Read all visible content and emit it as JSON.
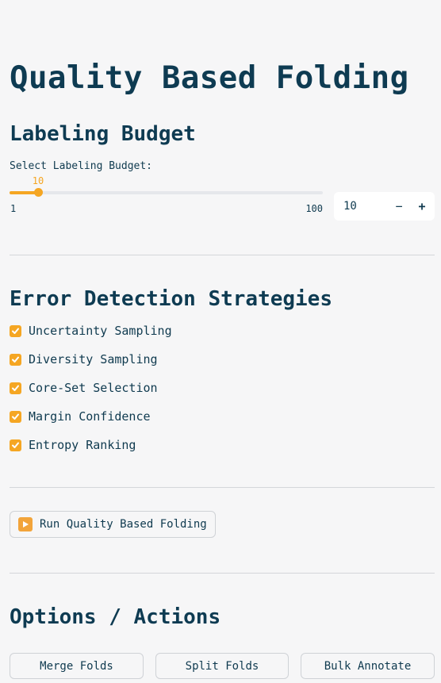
{
  "title": "Quality Based Folding",
  "budget": {
    "heading": "Labeling Budget",
    "label": "Select Labeling Budget:",
    "value": 10,
    "value_text": "10",
    "min": 1,
    "min_text": "1",
    "max": 100,
    "max_text": "100",
    "input_value": "10",
    "decrement_glyph": "−",
    "increment_glyph": "+"
  },
  "strategies": {
    "heading": "Error Detection Strategies",
    "items": [
      {
        "label": "Uncertainty Sampling",
        "checked": true
      },
      {
        "label": "Diversity Sampling",
        "checked": true
      },
      {
        "label": "Core-Set Selection",
        "checked": true
      },
      {
        "label": "Margin Confidence",
        "checked": true
      },
      {
        "label": "Entropy Ranking",
        "checked": true
      }
    ]
  },
  "run_button": {
    "label": "Run Quality Based Folding",
    "icon": "play-icon"
  },
  "actions": {
    "heading": "Options / Actions",
    "buttons": [
      "Merge Folds",
      "Split Folds",
      "Bulk Annotate"
    ]
  },
  "colors": {
    "accent": "#f5a623",
    "text": "#0f3a4f",
    "background": "#f6f6f7"
  }
}
